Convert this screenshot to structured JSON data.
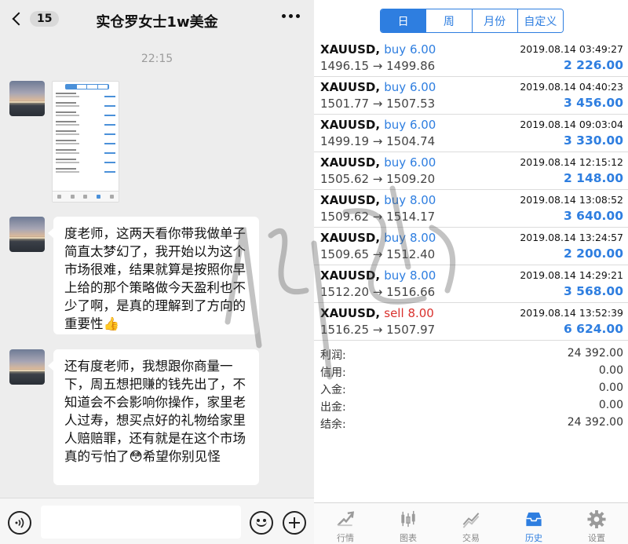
{
  "chat": {
    "header": {
      "back_count": "15",
      "title": "实仓罗女士1w美金"
    },
    "time": "22:15",
    "messages": [
      {
        "type": "image"
      },
      {
        "type": "text",
        "text": "度老师，这两天看你带我做单子简直太梦幻了，我开始以为这个市场很难，结果就算是按照你早上给的那个策略做今天盈利也不少了啊，是真的理解到了方向的重要性👍"
      },
      {
        "type": "text",
        "text": "还有度老师，我想跟你商量一下，周五想把赚的钱先出了，不知道会不会影响你操作，家里老人过寿，想买点好的礼物给家里人赔赔罪，还有就是在这个市场真的亏怕了😳希望你别见怪"
      }
    ],
    "input": {
      "placeholder": ""
    }
  },
  "trade": {
    "tabs": [
      {
        "label": "日",
        "active": true
      },
      {
        "label": "周",
        "active": false
      },
      {
        "label": "月份",
        "active": false
      },
      {
        "label": "自定义",
        "active": false
      }
    ],
    "orders": [
      {
        "symbol": "XAUUSD,",
        "side": "buy",
        "volume": "6.00",
        "prices": "1496.15 → 1499.86",
        "time": "2019.08.14 03:49:27",
        "profit": "2 226.00"
      },
      {
        "symbol": "XAUUSD,",
        "side": "buy",
        "volume": "6.00",
        "prices": "1501.77 → 1507.53",
        "time": "2019.08.14 04:40:23",
        "profit": "3 456.00"
      },
      {
        "symbol": "XAUUSD,",
        "side": "buy",
        "volume": "6.00",
        "prices": "1499.19 → 1504.74",
        "time": "2019.08.14 09:03:04",
        "profit": "3 330.00"
      },
      {
        "symbol": "XAUUSD,",
        "side": "buy",
        "volume": "6.00",
        "prices": "1505.62 → 1509.20",
        "time": "2019.08.14 12:15:12",
        "profit": "2 148.00"
      },
      {
        "symbol": "XAUUSD,",
        "side": "buy",
        "volume": "8.00",
        "prices": "1509.62 → 1514.17",
        "time": "2019.08.14 13:08:52",
        "profit": "3 640.00"
      },
      {
        "symbol": "XAUUSD,",
        "side": "buy",
        "volume": "8.00",
        "prices": "1509.65 → 1512.40",
        "time": "2019.08.14 13:24:57",
        "profit": "2 200.00"
      },
      {
        "symbol": "XAUUSD,",
        "side": "buy",
        "volume": "8.00",
        "prices": "1512.20 → 1516.66",
        "time": "2019.08.14 14:29:21",
        "profit": "3 568.00"
      },
      {
        "symbol": "XAUUSD,",
        "side": "sell",
        "volume": "8.00",
        "prices": "1516.25 → 1507.97",
        "time": "2019.08.14 13:52:39",
        "profit": "6 624.00"
      }
    ],
    "summary": [
      {
        "label": "利润:",
        "value": "24 392.00"
      },
      {
        "label": "信用:",
        "value": "0.00"
      },
      {
        "label": "入金:",
        "value": "0.00"
      },
      {
        "label": "出金:",
        "value": "0.00"
      },
      {
        "label": "结余:",
        "value": "24 392.00"
      }
    ],
    "tabbar": [
      {
        "label": "行情",
        "icon": "quotes-icon",
        "active": false
      },
      {
        "label": "图表",
        "icon": "chart-icon",
        "active": false
      },
      {
        "label": "交易",
        "icon": "trade-icon",
        "active": false
      },
      {
        "label": "历史",
        "icon": "history-icon",
        "active": true
      },
      {
        "label": "设置",
        "icon": "settings-icon",
        "active": false
      }
    ],
    "colors": {
      "accent": "#2e7ee0",
      "sell": "#d9302c"
    }
  }
}
